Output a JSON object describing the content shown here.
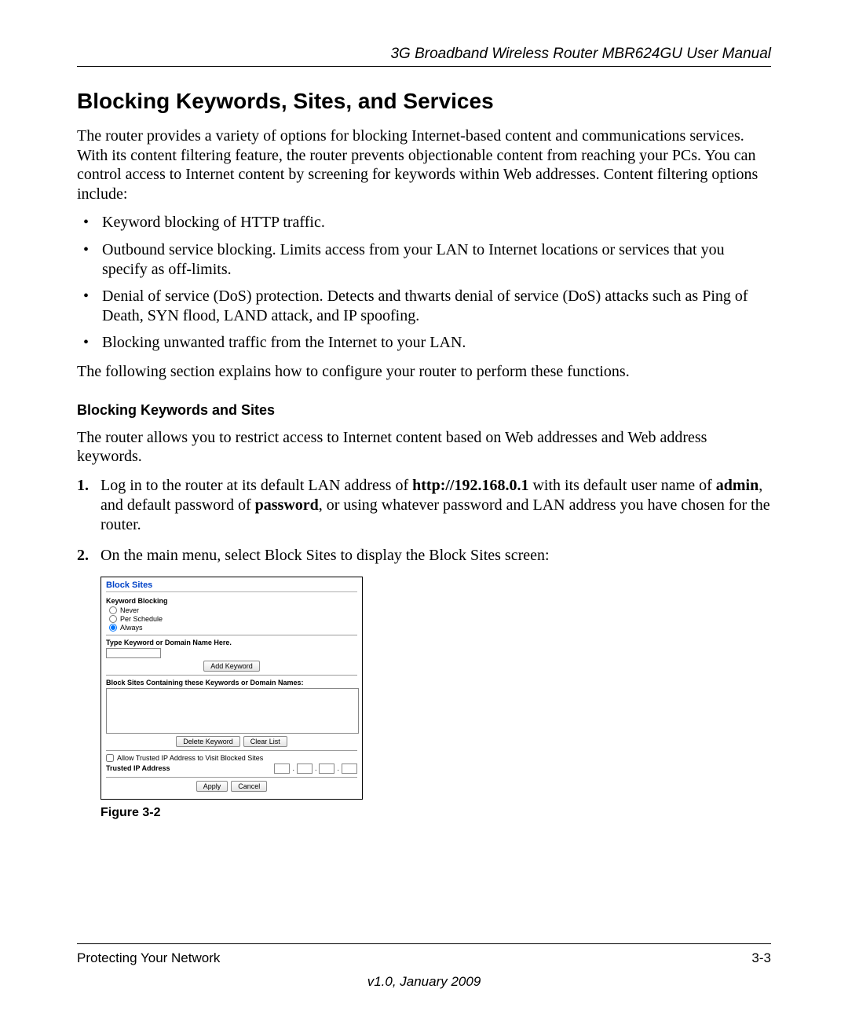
{
  "header": {
    "running": "3G Broadband Wireless Router MBR624GU User Manual"
  },
  "title": "Blocking Keywords, Sites, and Services",
  "intro": "The router provides a variety of options for blocking Internet-based content and communications services. With its content filtering feature, the router prevents objectionable content from reaching your PCs. You can control access to Internet content by screening for keywords within Web addresses. Content filtering options include:",
  "bullets": [
    "Keyword blocking of HTTP traffic.",
    "Outbound service blocking. Limits access from your LAN to Internet locations or services that you specify as off-limits.",
    "Denial of service (DoS) protection. Detects and thwarts denial of service (DoS) attacks such as Ping of Death, SYN flood, LAND attack, and IP spoofing.",
    "Blocking unwanted traffic from the Internet to your LAN."
  ],
  "posttext": "The following section explains how to configure your router to perform these functions.",
  "subsection": "Blocking Keywords and Sites",
  "subintro": "The router allows you to restrict access to Internet content based on Web addresses and Web address keywords.",
  "steps": {
    "s1_prefix": "Log in to the router at its default LAN address of ",
    "s1_addr": "http://192.168.0.1",
    "s1_mid1": " with its default user name of ",
    "s1_user": "admin",
    "s1_mid2": ", and default password of ",
    "s1_pass": "password",
    "s1_suffix": ", or using whatever password and LAN address you have chosen for the router.",
    "s2": "On the main menu, select Block Sites to display the Block Sites screen:"
  },
  "screenshot": {
    "title": "Block Sites",
    "keyword_blocking": "Keyword Blocking",
    "radios": {
      "never": "Never",
      "per_schedule": "Per Schedule",
      "always": "Always"
    },
    "type_label": "Type Keyword or Domain Name Here.",
    "add": "Add Keyword",
    "list_label": "Block Sites Containing these Keywords or Domain Names:",
    "delete": "Delete Keyword",
    "clear": "Clear List",
    "allow_check": "Allow Trusted IP Address to Visit Blocked Sites",
    "trusted": "Trusted IP Address",
    "apply": "Apply",
    "cancel": "Cancel"
  },
  "figure_caption": "Figure 3-2",
  "footer": {
    "chapter": "Protecting Your Network",
    "page": "3-3",
    "version": "v1.0, January 2009"
  }
}
